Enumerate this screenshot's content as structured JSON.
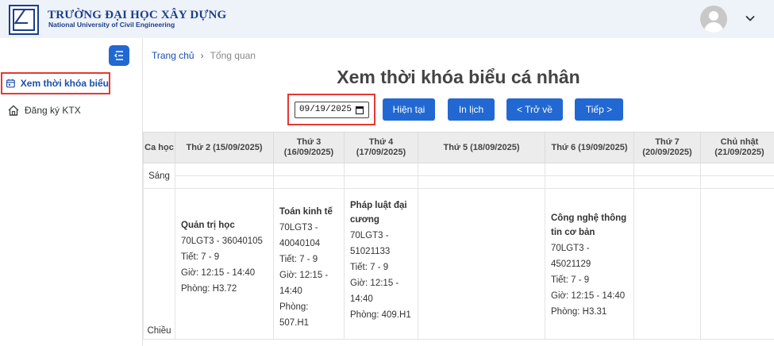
{
  "header": {
    "title": "TRƯỜNG ĐẠI HỌC XÂY DỰNG",
    "subtitle": "National University of Civil Engineering",
    "logo_text": "XÂY DỰNG"
  },
  "sidebar": {
    "items": [
      {
        "label": "Xem thời khóa biểu",
        "icon": "calendar-icon"
      },
      {
        "label": "Đăng ký KTX",
        "icon": "home-icon"
      }
    ]
  },
  "breadcrumb": {
    "home": "Trang chủ",
    "current": "Tổng quan"
  },
  "page_title": "Xem thời khóa biểu cá nhân",
  "date_field": {
    "value": "09/19/2025"
  },
  "buttons": {
    "today": "Hiện tại",
    "print": "In lịch",
    "back": "< Trở về",
    "next": "Tiếp >"
  },
  "table": {
    "session_header": "Ca học",
    "days": [
      "Thứ 2 (15/09/2025)",
      "Thứ 3 (16/09/2025)",
      "Thứ 4 (17/09/2025)",
      "Thứ 5 (18/09/2025)",
      "Thứ 6 (19/09/2025)",
      "Thứ 7 (20/09/2025)",
      "Chủ nhật (21/09/2025)"
    ],
    "sessions": [
      "Sáng",
      "Chiều"
    ],
    "afternoon": [
      {
        "name": "Quản trị học",
        "code": "70LGT3 - 36040105",
        "period": "Tiết: 7 - 9",
        "time": "Giờ: 12:15 - 14:40",
        "room": "Phòng: H3.72"
      },
      {
        "name": "Toán kinh tế",
        "code": "70LGT3 - 40040104",
        "period": "Tiết: 7 - 9",
        "time": "Giờ: 12:15 - 14:40",
        "room": "Phòng: 507.H1"
      },
      {
        "name": "Pháp luật đại cương",
        "code": "70LGT3 - 51021133",
        "period": "Tiết: 7 - 9",
        "time": "Giờ: 12:15 - 14:40",
        "room": "Phòng: 409.H1"
      },
      null,
      {
        "name": "Công nghệ thông tin cơ bản",
        "code": "70LGT3 - 45021129",
        "period": "Tiết: 7 - 9",
        "time": "Giờ: 12:15 - 14:40",
        "room": "Phòng: H3.31"
      },
      null,
      null
    ]
  }
}
